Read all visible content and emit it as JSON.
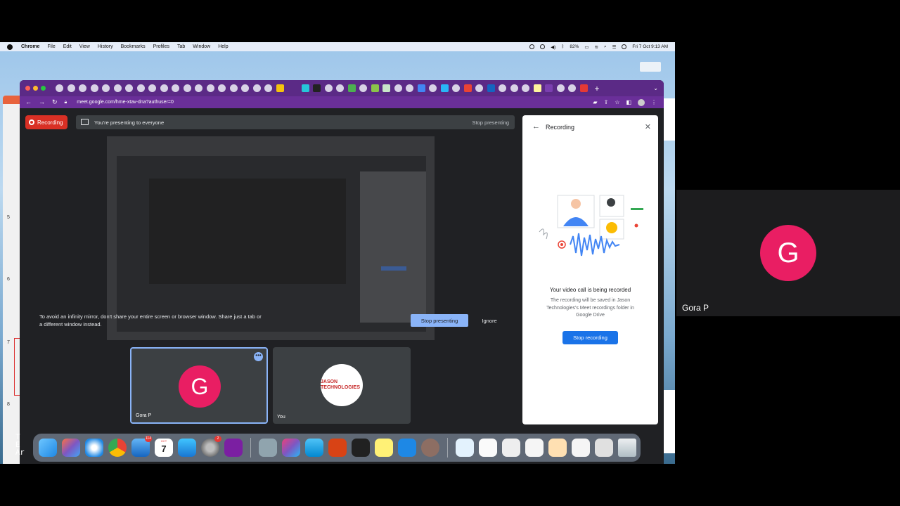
{
  "mac_menubar": {
    "app": "Chrome",
    "items": [
      "File",
      "Edit",
      "View",
      "History",
      "Bookmarks",
      "Profiles",
      "Tab",
      "Window",
      "Help"
    ],
    "battery": "82%",
    "clock": "Fri 7 Oct  9:13 AM"
  },
  "browser": {
    "url": "meet.google.com/hme-xtav-dna?authuser=0"
  },
  "meet": {
    "recording_badge": "Recording",
    "presenting_text": "You're presenting to everyone",
    "stop_presenting_link": "Stop presenting",
    "infinity_warning": "To avoid an infinity mirror, don't share your entire screen or browser window. Share just a tab or a different window instead.",
    "stop_presenting_button": "Stop presenting",
    "ignore_button": "Ignore",
    "tiles": [
      {
        "initial": "G",
        "name": "Gora P",
        "avatar_color": "#e91e63"
      },
      {
        "name": "You",
        "logo_text": "JASON TECHNOLOGIES"
      }
    ]
  },
  "recording_panel": {
    "title": "Recording",
    "heading": "Your video call is being recorded",
    "description": "The recording will be saved in Jason Technologies's Meet recordings folder in Google Drive",
    "button": "Stop recording"
  },
  "dock": {
    "mail_badge": "114",
    "settings_badge": "2",
    "calendar_month": "OCT",
    "calendar_day": "7"
  },
  "side_participant": {
    "initial": "G",
    "name": "Gora P",
    "avatar_color": "#e91e63"
  },
  "colors": {
    "tab_strip": "#5b2a86",
    "recording_red": "#d93025",
    "primary_blue": "#1a73e8",
    "meet_dark": "#202124"
  }
}
